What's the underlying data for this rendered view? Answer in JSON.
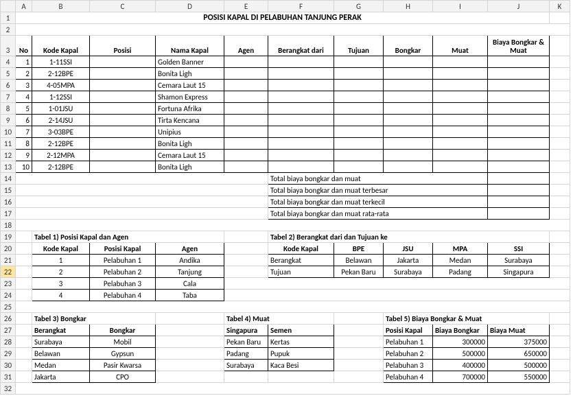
{
  "cols": [
    "",
    "A",
    "B",
    "C",
    "D",
    "E",
    "F",
    "G",
    "H",
    "I",
    "J",
    "K"
  ],
  "title": "POSISI KAPAL DI PELABUHAN TANJUNG PERAK",
  "main": {
    "headers": [
      "No",
      "Kode Kapal",
      "Posisi",
      "Nama Kapal",
      "Agen",
      "Berangkat dari",
      "Tujuan",
      "Bongkar",
      "Muat",
      "Biaya Bongkar & Muat"
    ],
    "rows": [
      {
        "no": "1",
        "kode": "1-11SSI",
        "nama": "Golden Banner"
      },
      {
        "no": "2",
        "kode": "2-12BPE",
        "nama": "Bonita Ligh"
      },
      {
        "no": "3",
        "kode": "4-05MPA",
        "nama": "Cemara Laut 15"
      },
      {
        "no": "4",
        "kode": "1-12SSI",
        "nama": "Shamon Express"
      },
      {
        "no": "5",
        "kode": "1-01JSU",
        "nama": "Fortuna Afrika"
      },
      {
        "no": "6",
        "kode": "2-14JSU",
        "nama": "Tirta Kencana"
      },
      {
        "no": "7",
        "kode": "3-03BPE",
        "nama": "Unipius"
      },
      {
        "no": "8",
        "kode": "2-12BPE",
        "nama": "Bonita Ligh"
      },
      {
        "no": "9",
        "kode": "2-12MPA",
        "nama": "Cemara Laut 15"
      },
      {
        "no": "10",
        "kode": "2-12BPE",
        "nama": "Bonita Ligh"
      }
    ],
    "totals": [
      "Total biaya bongkar dan muat",
      "Total biaya bongkar dan muat terbesar",
      "Total biaya bongkar dan muat terkecil",
      "Total biaya bongkar dan muat rata-rata"
    ]
  },
  "t1": {
    "title": "Tabel 1) Posisi Kapal dan Agen",
    "h": [
      "Kode Kapal",
      "Posisi Kapal",
      "Agen"
    ],
    "rows": [
      [
        "1",
        "Pelabuhan 1",
        "Andika"
      ],
      [
        "2",
        "Pelabuhan 2",
        "Tanjung"
      ],
      [
        "3",
        "Pelabuhan 3",
        "Cala"
      ],
      [
        "4",
        "Pelabuhan 4",
        "Taba"
      ]
    ]
  },
  "t2": {
    "title": "Tabel 2) Berangkat dari dan Tujuan ke",
    "h": [
      "Kode Kapal",
      "BPE",
      "JSU",
      "MPA",
      "SSI"
    ],
    "rows": [
      [
        "Berangkat",
        "Belawan",
        "Jakarta",
        "Medan",
        "Surabaya"
      ],
      [
        "Tujuan",
        "Pekan Baru",
        "Surabaya",
        "Padang",
        "Singapura"
      ]
    ]
  },
  "t3": {
    "title": "Tabel 3) Bongkar",
    "h": [
      "Berangkat",
      "Bongkar"
    ],
    "rows": [
      [
        "Surabaya",
        "Mobil"
      ],
      [
        "Belawan",
        "Gypsun"
      ],
      [
        "Medan",
        "Pasir Kwarsa"
      ],
      [
        "Jakarta",
        "CPO"
      ]
    ]
  },
  "t4": {
    "title": "Tabel 4) Muat",
    "rows": [
      [
        "Singapura",
        "Semen"
      ],
      [
        "Pekan Baru",
        "Kertas"
      ],
      [
        "Padang",
        "Pupuk"
      ],
      [
        "Surabaya",
        "Kaca Besi"
      ]
    ]
  },
  "t5": {
    "title": "Tabel 5) Biaya Bongkar & Muat",
    "h": [
      "Posisi Kapal",
      "Biaya Bongkar",
      "Biaya Muat"
    ],
    "rows": [
      [
        "Pelabuhan 1",
        "300000",
        "375000"
      ],
      [
        "Pelabuhan 2",
        "500000",
        "650000"
      ],
      [
        "Pelabuhan 3",
        "400000",
        "500000"
      ],
      [
        "Pelabuhan 4",
        "700000",
        "550000"
      ]
    ]
  },
  "chart_data": {
    "type": "table",
    "title": "POSISI KAPAL DI PELABUHAN TANJUNG PERAK",
    "tables": {
      "biaya_bongkar_muat": {
        "columns": [
          "Posisi Kapal",
          "Biaya Bongkar",
          "Biaya Muat"
        ],
        "rows": [
          [
            "Pelabuhan 1",
            300000,
            375000
          ],
          [
            "Pelabuhan 2",
            500000,
            650000
          ],
          [
            "Pelabuhan 3",
            400000,
            500000
          ],
          [
            "Pelabuhan 4",
            700000,
            550000
          ]
        ]
      }
    }
  }
}
